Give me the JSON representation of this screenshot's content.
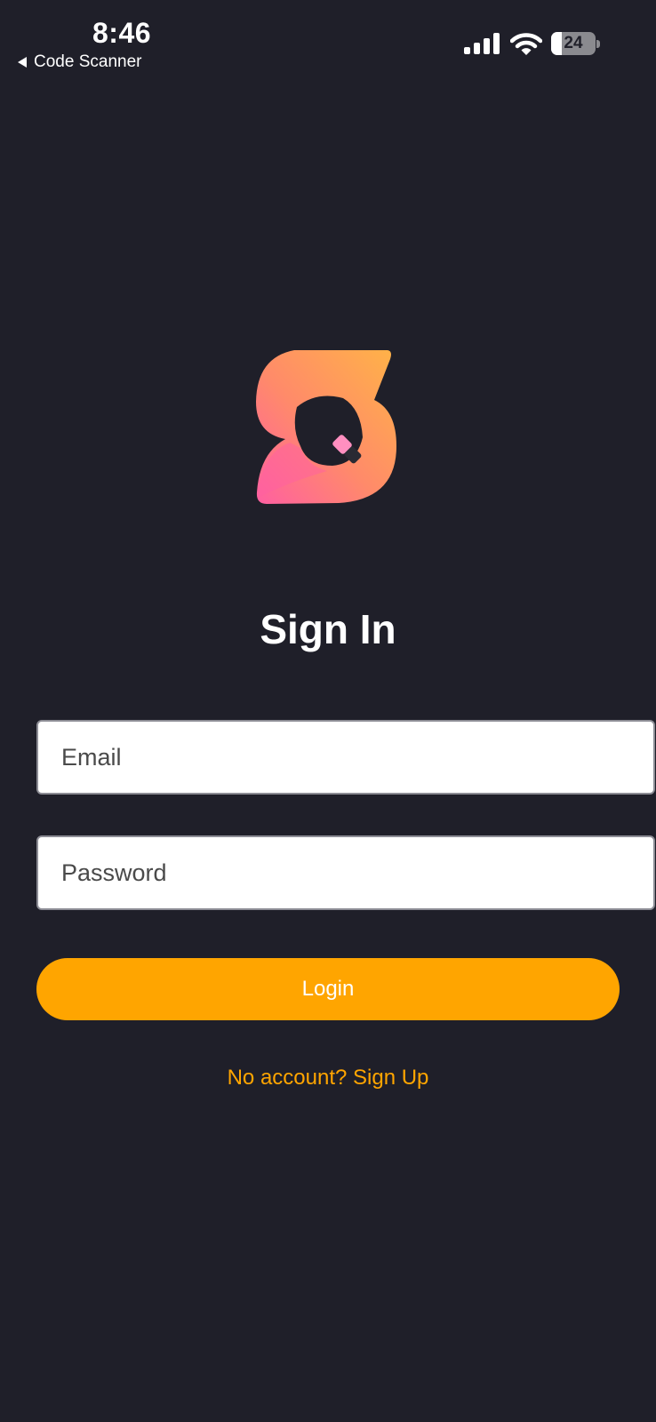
{
  "status_bar": {
    "time": "8:46",
    "back_label": "Code Scanner",
    "battery_percent": "24",
    "battery_level": 0.24
  },
  "auth": {
    "title": "Sign In",
    "email_placeholder": "Email",
    "email_value": "",
    "password_placeholder": "Password",
    "password_value": "",
    "login_label": "Login",
    "signup_link": "No account? Sign Up"
  },
  "icons": {
    "back": "back-arrow-icon",
    "signal": "cellular-signal-icon",
    "wifi": "wifi-icon",
    "battery": "battery-icon",
    "logo": "app-logo"
  },
  "colors": {
    "background": "#1f1f29",
    "accent": "#ffa500",
    "logo_gradient_top": "#ffb347",
    "logo_gradient_bottom": "#ff5fa2"
  }
}
